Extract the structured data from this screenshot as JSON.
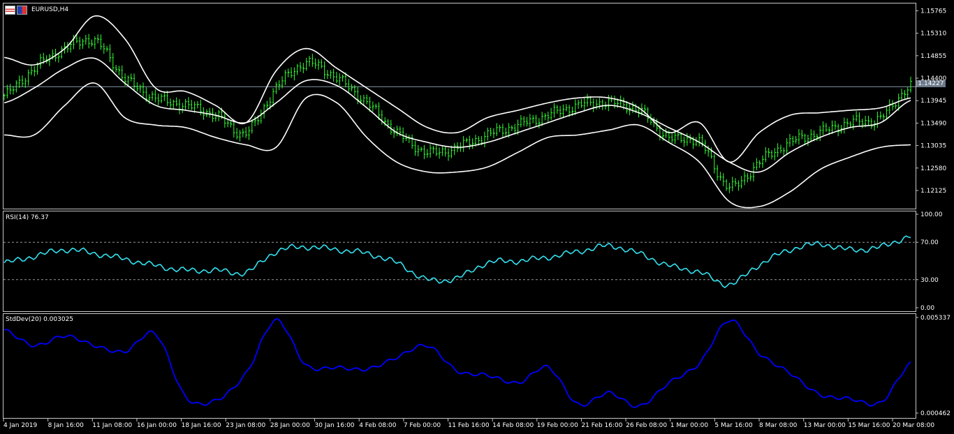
{
  "main": {
    "title": "EURUSD,H4",
    "current_price": "1.14227",
    "price_ticks": [
      "1.15765",
      "1.15310",
      "1.14855",
      "1.14400",
      "1.13945",
      "1.13490",
      "1.13035",
      "1.12580",
      "1.12125"
    ],
    "candle_color": "#33ff33",
    "band_color": "#ffffff",
    "price_line_color": "#8899aa"
  },
  "rsi": {
    "label": "RSI(14) 76.37",
    "ticks": [
      "100.00",
      "70.00",
      "30.00",
      "0.00"
    ],
    "levels": [
      70,
      30
    ],
    "color": "#33e0ee"
  },
  "stddev": {
    "label": "StdDev(20) 0.003025",
    "ticks": [
      "0.005337",
      "0.000462"
    ],
    "color": "#0000ff"
  },
  "x_axis": {
    "labels": [
      "4 Jan 2019",
      "8 Jan 16:00",
      "11 Jan 08:00",
      "16 Jan 00:00",
      "18 Jan 16:00",
      "23 Jan 08:00",
      "28 Jan 00:00",
      "30 Jan 16:00",
      "4 Feb 08:00",
      "7 Feb 00:00",
      "11 Feb 16:00",
      "14 Feb 08:00",
      "19 Feb 00:00",
      "21 Feb 16:00",
      "26 Feb 08:00",
      "1 Mar 00:00",
      "5 Mar 16:00",
      "8 Mar 08:00",
      "13 Mar 00:00",
      "15 Mar 16:00",
      "20 Mar 08:00"
    ]
  },
  "chart_data": [
    {
      "type": "line",
      "title": "EURUSD,H4",
      "ylim": [
        1.118,
        1.1587
      ],
      "x": [
        0,
        0.033,
        0.067,
        0.1,
        0.133,
        0.167,
        0.2,
        0.233,
        0.267,
        0.3,
        0.333,
        0.367,
        0.4,
        0.433,
        0.467,
        0.5,
        0.533,
        0.567,
        0.6,
        0.633,
        0.667,
        0.7,
        0.733,
        0.767,
        0.8,
        0.833,
        0.867,
        0.9,
        0.933,
        0.967,
        1.0
      ],
      "series": [
        {
          "name": "upper_band",
          "values": [
            1.1482,
            1.1467,
            1.15,
            1.1566,
            1.152,
            1.142,
            1.1413,
            1.1385,
            1.135,
            1.1455,
            1.15,
            1.146,
            1.142,
            1.138,
            1.134,
            1.133,
            1.136,
            1.1375,
            1.139,
            1.14,
            1.14,
            1.138,
            1.133,
            1.135,
            1.127,
            1.133,
            1.1365,
            1.137,
            1.1375,
            1.138,
            1.14
          ]
        },
        {
          "name": "middle_band",
          "values": [
            1.139,
            1.142,
            1.146,
            1.148,
            1.143,
            1.1385,
            1.1375,
            1.1365,
            1.135,
            1.139,
            1.1435,
            1.1425,
            1.138,
            1.133,
            1.131,
            1.13,
            1.131,
            1.133,
            1.135,
            1.137,
            1.1385,
            1.137,
            1.134,
            1.131,
            1.127,
            1.125,
            1.129,
            1.132,
            1.134,
            1.135,
            1.1395
          ]
        },
        {
          "name": "lower_band",
          "values": [
            1.1325,
            1.1325,
            1.1385,
            1.143,
            1.136,
            1.1345,
            1.134,
            1.132,
            1.1305,
            1.13,
            1.14,
            1.139,
            1.132,
            1.127,
            1.125,
            1.125,
            1.126,
            1.129,
            1.132,
            1.1325,
            1.1335,
            1.1345,
            1.131,
            1.127,
            1.119,
            1.118,
            1.121,
            1.1255,
            1.128,
            1.13,
            1.1305
          ]
        },
        {
          "name": "close",
          "values": [
            1.1405,
            1.146,
            1.15,
            1.1515,
            1.144,
            1.14,
            1.1385,
            1.1365,
            1.133,
            1.142,
            1.147,
            1.144,
            1.139,
            1.133,
            1.129,
            1.13,
            1.1325,
            1.1345,
            1.1365,
            1.1385,
            1.139,
            1.1375,
            1.132,
            1.131,
            1.122,
            1.127,
            1.131,
            1.133,
            1.135,
            1.136,
            1.1425
          ]
        }
      ]
    },
    {
      "type": "line",
      "title": "RSI(14) 76.37",
      "ylim": [
        0,
        100
      ],
      "x": [
        0,
        0.033,
        0.067,
        0.1,
        0.133,
        0.167,
        0.2,
        0.233,
        0.267,
        0.3,
        0.333,
        0.367,
        0.4,
        0.433,
        0.467,
        0.5,
        0.533,
        0.567,
        0.6,
        0.633,
        0.667,
        0.7,
        0.733,
        0.767,
        0.8,
        0.833,
        0.867,
        0.9,
        0.933,
        0.967,
        1.0
      ],
      "series": [
        {
          "name": "RSI(14)",
          "values": [
            48,
            55,
            62,
            58,
            52,
            45,
            40,
            40,
            38,
            60,
            65,
            62,
            58,
            48,
            30,
            32,
            48,
            50,
            54,
            60,
            66,
            58,
            45,
            38,
            25,
            46,
            62,
            68,
            62,
            65,
            76.37
          ]
        }
      ]
    },
    {
      "type": "line",
      "title": "StdDev(20) 0.003025",
      "ylim": [
        0.000462,
        0.005337
      ],
      "x": [
        0,
        0.033,
        0.067,
        0.1,
        0.133,
        0.167,
        0.2,
        0.233,
        0.267,
        0.3,
        0.333,
        0.367,
        0.4,
        0.433,
        0.467,
        0.5,
        0.533,
        0.567,
        0.6,
        0.633,
        0.667,
        0.7,
        0.733,
        0.767,
        0.8,
        0.833,
        0.867,
        0.9,
        0.933,
        0.967,
        1.0
      ],
      "series": [
        {
          "name": "StdDev(20)",
          "values": [
            0.0047,
            0.0039,
            0.0044,
            0.0039,
            0.0036,
            0.0045,
            0.0013,
            0.0011,
            0.0025,
            0.0052,
            0.0029,
            0.0028,
            0.0027,
            0.0033,
            0.0039,
            0.0026,
            0.0024,
            0.002,
            0.0028,
            0.0009,
            0.0015,
            0.0008,
            0.002,
            0.003,
            0.0052,
            0.0035,
            0.0025,
            0.0014,
            0.0012,
            0.001,
            0.003
          ]
        }
      ]
    }
  ]
}
